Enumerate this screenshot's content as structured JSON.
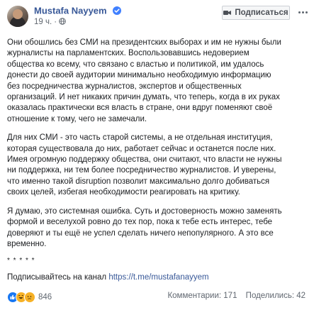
{
  "post": {
    "author": "Mustafa Nayyem",
    "time": "19 ч.",
    "subscribe_label": "Подписаться",
    "paragraphs": [
      "Они обошлись без СМИ на президентских выборах и им не нужны были\nжурналисты на парламентских. Воспользовавшись недоверием\nобщества ко всему, что связано с властью и политикой, им удалось\nдонести до своей аудитории минимально необходимую информацию\nбез посредничества журналистов, экспертов и общественных\nорганизаций. И нет никаких причин думать, что теперь, когда в их руках\nоказалась практически вся власть в стране, они вдруг поменяют своё\nотношение к тому, чего не замечали.",
      "Для них СМИ - это часть старой системы, а не отдельная институция,\nкоторая существовала до них, работает сейчас и останется после них.\nИмея огромную поддержку общества, они считают, что власти не нужны\nни поддержка, ни тем более посредничество журналистов. И уверены,\nчто именно такой disruption позволит максимально долго добиваться\nсвоих целей, избегая необходимости реагировать на критику.",
      "Я думаю, это системная ошибка. Суть и достоверность можно заменять\nформой и веселухой ровно до тех пор, пока к тебе есть интерес, тебе\nдоверяют и ты ещё не успел сделать ничего непопулярного. А это все\nвременно."
    ],
    "stars": "* * * * *",
    "subscribe_text": "Подписывайтесь на канал",
    "channel_link": "https://t.me/mustafanayyem"
  },
  "reactions": {
    "icons": [
      "like-icon",
      "haha-icon",
      "sad-icon"
    ],
    "count": "846"
  },
  "stats": {
    "comments": "Комментарии: 171",
    "shares": "Поделились: 42"
  },
  "colors": {
    "link": "#385898",
    "text": "#1c1e21",
    "meta": "#606770",
    "like": "#1877f2"
  }
}
